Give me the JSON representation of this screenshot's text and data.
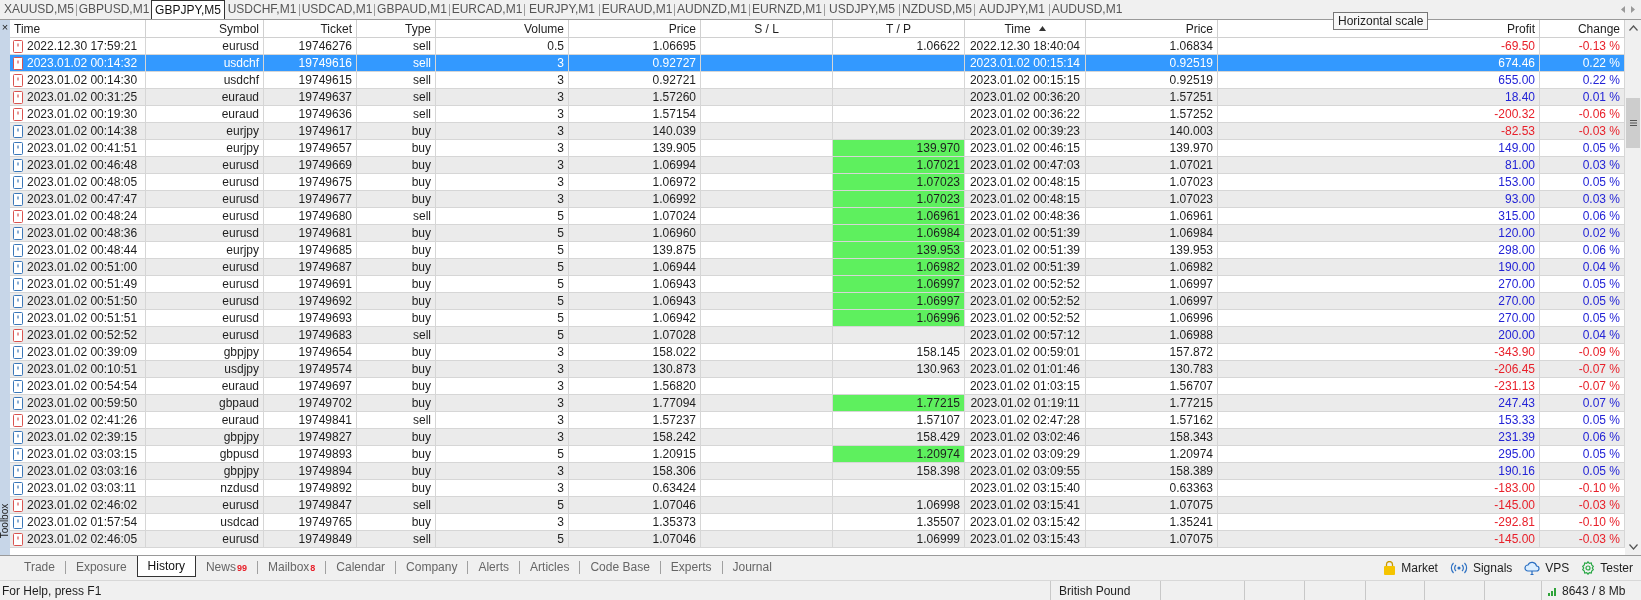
{
  "chart_tabs": [
    {
      "label": "XAUUSD,M5",
      "selected": false
    },
    {
      "label": "GBPUSD,M1",
      "selected": false
    },
    {
      "label": "GBPJPY,M5",
      "selected": true
    },
    {
      "label": "USDCHF,M1",
      "selected": false
    },
    {
      "label": "USDCAD,M1",
      "selected": false
    },
    {
      "label": "GBPAUD,M1",
      "selected": false
    },
    {
      "label": "EURCAD,M1",
      "selected": false
    },
    {
      "label": "EURJPY,M1",
      "selected": false
    },
    {
      "label": "EURAUD,M1",
      "selected": false
    },
    {
      "label": "AUDNZD,M1",
      "selected": false
    },
    {
      "label": "EURNZD,M1",
      "selected": false
    },
    {
      "label": "USDJPY,M5",
      "selected": false
    },
    {
      "label": "NZDUSD,M5",
      "selected": false
    },
    {
      "label": "AUDJPY,M1",
      "selected": false
    },
    {
      "label": "AUDUSD,M1",
      "selected": false
    }
  ],
  "tooltip": "Horizontal scale",
  "toolbox": {
    "close": "×",
    "label": "Toolbox"
  },
  "table": {
    "columns": [
      {
        "label": "Time",
        "sorted": false
      },
      {
        "label": "Symbol",
        "sorted": false
      },
      {
        "label": "Ticket",
        "sorted": false
      },
      {
        "label": "Type",
        "sorted": false
      },
      {
        "label": "Volume",
        "sorted": false
      },
      {
        "label": "Price",
        "sorted": false
      },
      {
        "label": "S / L",
        "sorted": false
      },
      {
        "label": "T / P",
        "sorted": false
      },
      {
        "label": "Time",
        "sorted": true
      },
      {
        "label": "Price",
        "sorted": false
      },
      {
        "label": "Profit",
        "sorted": false
      },
      {
        "label": "Change",
        "sorted": false
      }
    ],
    "rows": [
      {
        "kind": "sell",
        "selected": false,
        "time": "2022.12.30 17:59:21",
        "symbol": "eurusd",
        "ticket": "19746276",
        "type": "sell",
        "volume": "0.5",
        "price": "1.06695",
        "tp": "1.06622",
        "tp_hit": false,
        "close_time": "2022.12.30 18:40:04",
        "close_price": "1.06834",
        "profit": "-69.50",
        "change": "-0.13 %",
        "loss": true
      },
      {
        "kind": "sell",
        "selected": true,
        "time": "2023.01.02 00:14:32",
        "symbol": "usdchf",
        "ticket": "19749616",
        "type": "sell",
        "volume": "3",
        "price": "0.92727",
        "tp_hit": false,
        "close_time": "2023.01.02 00:15:14",
        "close_price": "0.92519",
        "profit": "674.46",
        "change": "0.22 %"
      },
      {
        "kind": "sell",
        "selected": false,
        "time": "2023.01.02 00:14:30",
        "symbol": "usdchf",
        "ticket": "19749615",
        "type": "sell",
        "volume": "3",
        "price": "0.92721",
        "tp_hit": false,
        "close_time": "2023.01.02 00:15:15",
        "close_price": "0.92519",
        "profit": "655.00",
        "change": "0.22 %",
        "loss": false
      },
      {
        "kind": "sell",
        "selected": false,
        "time": "2023.01.02 00:31:25",
        "symbol": "euraud",
        "ticket": "19749637",
        "type": "sell",
        "volume": "3",
        "price": "1.57260",
        "tp_hit": false,
        "close_time": "2023.01.02 00:36:20",
        "close_price": "1.57251",
        "profit": "18.40",
        "change": "0.01 %",
        "loss": false
      },
      {
        "kind": "sell",
        "selected": false,
        "time": "2023.01.02 00:19:30",
        "symbol": "euraud",
        "ticket": "19749636",
        "type": "sell",
        "volume": "3",
        "price": "1.57154",
        "tp_hit": false,
        "close_time": "2023.01.02 00:36:22",
        "close_price": "1.57252",
        "profit": "-200.32",
        "change": "-0.06 %",
        "loss": true
      },
      {
        "kind": "buy",
        "selected": false,
        "time": "2023.01.02 00:14:38",
        "symbol": "eurjpy",
        "ticket": "19749617",
        "type": "buy",
        "volume": "3",
        "price": "140.039",
        "tp_hit": false,
        "close_time": "2023.01.02 00:39:23",
        "close_price": "140.003",
        "profit": "-82.53",
        "change": "-0.03 %",
        "loss": true
      },
      {
        "kind": "buy",
        "selected": false,
        "time": "2023.01.02 00:41:51",
        "symbol": "eurjpy",
        "ticket": "19749657",
        "type": "buy",
        "volume": "3",
        "price": "139.905",
        "tp": "139.970",
        "tp_hit": true,
        "close_time": "2023.01.02 00:46:15",
        "close_price": "139.970",
        "profit": "149.00",
        "change": "0.05 %",
        "loss": false
      },
      {
        "kind": "buy",
        "selected": false,
        "time": "2023.01.02 00:46:48",
        "symbol": "eurusd",
        "ticket": "19749669",
        "type": "buy",
        "volume": "3",
        "price": "1.06994",
        "tp": "1.07021",
        "tp_hit": true,
        "close_time": "2023.01.02 00:47:03",
        "close_price": "1.07021",
        "profit": "81.00",
        "change": "0.03 %",
        "loss": false
      },
      {
        "kind": "buy",
        "selected": false,
        "time": "2023.01.02 00:48:05",
        "symbol": "eurusd",
        "ticket": "19749675",
        "type": "buy",
        "volume": "3",
        "price": "1.06972",
        "tp": "1.07023",
        "tp_hit": true,
        "close_time": "2023.01.02 00:48:15",
        "close_price": "1.07023",
        "profit": "153.00",
        "change": "0.05 %",
        "loss": false
      },
      {
        "kind": "buy",
        "selected": false,
        "time": "2023.01.02 00:47:47",
        "symbol": "eurusd",
        "ticket": "19749677",
        "type": "buy",
        "volume": "3",
        "price": "1.06992",
        "tp": "1.07023",
        "tp_hit": true,
        "close_time": "2023.01.02 00:48:15",
        "close_price": "1.07023",
        "profit": "93.00",
        "change": "0.03 %",
        "loss": false
      },
      {
        "kind": "sell",
        "selected": false,
        "time": "2023.01.02 00:48:24",
        "symbol": "eurusd",
        "ticket": "19749680",
        "type": "sell",
        "volume": "5",
        "price": "1.07024",
        "tp": "1.06961",
        "tp_hit": true,
        "close_time": "2023.01.02 00:48:36",
        "close_price": "1.06961",
        "profit": "315.00",
        "change": "0.06 %",
        "loss": false
      },
      {
        "kind": "buy",
        "selected": false,
        "time": "2023.01.02 00:48:36",
        "symbol": "eurusd",
        "ticket": "19749681",
        "type": "buy",
        "volume": "5",
        "price": "1.06960",
        "tp": "1.06984",
        "tp_hit": true,
        "close_time": "2023.01.02 00:51:39",
        "close_price": "1.06984",
        "profit": "120.00",
        "change": "0.02 %",
        "loss": false
      },
      {
        "kind": "buy",
        "selected": false,
        "time": "2023.01.02 00:48:44",
        "symbol": "eurjpy",
        "ticket": "19749685",
        "type": "buy",
        "volume": "5",
        "price": "139.875",
        "tp": "139.953",
        "tp_hit": true,
        "close_time": "2023.01.02 00:51:39",
        "close_price": "139.953",
        "profit": "298.00",
        "change": "0.06 %",
        "loss": false
      },
      {
        "kind": "buy",
        "selected": false,
        "time": "2023.01.02 00:51:00",
        "symbol": "eurusd",
        "ticket": "19749687",
        "type": "buy",
        "volume": "5",
        "price": "1.06944",
        "tp": "1.06982",
        "tp_hit": true,
        "close_time": "2023.01.02 00:51:39",
        "close_price": "1.06982",
        "profit": "190.00",
        "change": "0.04 %",
        "loss": false
      },
      {
        "kind": "buy",
        "selected": false,
        "time": "2023.01.02 00:51:49",
        "symbol": "eurusd",
        "ticket": "19749691",
        "type": "buy",
        "volume": "5",
        "price": "1.06943",
        "tp": "1.06997",
        "tp_hit": true,
        "close_time": "2023.01.02 00:52:52",
        "close_price": "1.06997",
        "profit": "270.00",
        "change": "0.05 %",
        "loss": false
      },
      {
        "kind": "buy",
        "selected": false,
        "time": "2023.01.02 00:51:50",
        "symbol": "eurusd",
        "ticket": "19749692",
        "type": "buy",
        "volume": "5",
        "price": "1.06943",
        "tp": "1.06997",
        "tp_hit": true,
        "close_time": "2023.01.02 00:52:52",
        "close_price": "1.06997",
        "profit": "270.00",
        "change": "0.05 %",
        "loss": false
      },
      {
        "kind": "buy",
        "selected": false,
        "time": "2023.01.02 00:51:51",
        "symbol": "eurusd",
        "ticket": "19749693",
        "type": "buy",
        "volume": "5",
        "price": "1.06942",
        "tp": "1.06996",
        "tp_hit": true,
        "close_time": "2023.01.02 00:52:52",
        "close_price": "1.06996",
        "profit": "270.00",
        "change": "0.05 %",
        "loss": false
      },
      {
        "kind": "sell",
        "selected": false,
        "time": "2023.01.02 00:52:52",
        "symbol": "eurusd",
        "ticket": "19749683",
        "type": "sell",
        "volume": "5",
        "price": "1.07028",
        "tp_hit": false,
        "close_time": "2023.01.02 00:57:12",
        "close_price": "1.06988",
        "profit": "200.00",
        "change": "0.04 %",
        "loss": false
      },
      {
        "kind": "buy",
        "selected": false,
        "time": "2023.01.02 00:39:09",
        "symbol": "gbpjpy",
        "ticket": "19749654",
        "type": "buy",
        "volume": "3",
        "price": "158.022",
        "tp": "158.145",
        "tp_hit": false,
        "close_time": "2023.01.02 00:59:01",
        "close_price": "157.872",
        "profit": "-343.90",
        "change": "-0.09 %",
        "loss": true
      },
      {
        "kind": "buy",
        "selected": false,
        "time": "2023.01.02 00:10:51",
        "symbol": "usdjpy",
        "ticket": "19749574",
        "type": "buy",
        "volume": "3",
        "price": "130.873",
        "tp": "130.963",
        "tp_hit": false,
        "close_time": "2023.01.02 01:01:46",
        "close_price": "130.783",
        "profit": "-206.45",
        "change": "-0.07 %",
        "loss": true
      },
      {
        "kind": "buy",
        "selected": false,
        "time": "2023.01.02 00:54:54",
        "symbol": "euraud",
        "ticket": "19749697",
        "type": "buy",
        "volume": "3",
        "price": "1.56820",
        "tp_hit": false,
        "close_time": "2023.01.02 01:03:15",
        "close_price": "1.56707",
        "profit": "-231.13",
        "change": "-0.07 %",
        "loss": true
      },
      {
        "kind": "buy",
        "selected": false,
        "time": "2023.01.02 00:59:50",
        "symbol": "gbpaud",
        "ticket": "19749702",
        "type": "buy",
        "volume": "3",
        "price": "1.77094",
        "tp": "1.77215",
        "tp_hit": true,
        "close_time": "2023.01.02 01:19:11",
        "close_price": "1.77215",
        "profit": "247.43",
        "change": "0.07 %",
        "loss": false
      },
      {
        "kind": "sell",
        "selected": false,
        "time": "2023.01.02 02:41:26",
        "symbol": "euraud",
        "ticket": "19749841",
        "type": "sell",
        "volume": "3",
        "price": "1.57237",
        "tp": "1.57107",
        "tp_hit": false,
        "close_time": "2023.01.02 02:47:28",
        "close_price": "1.57162",
        "profit": "153.33",
        "change": "0.05 %",
        "loss": false
      },
      {
        "kind": "buy",
        "selected": false,
        "time": "2023.01.02 02:39:15",
        "symbol": "gbpjpy",
        "ticket": "19749827",
        "type": "buy",
        "volume": "3",
        "price": "158.242",
        "tp": "158.429",
        "tp_hit": false,
        "close_time": "2023.01.02 03:02:46",
        "close_price": "158.343",
        "profit": "231.39",
        "change": "0.06 %",
        "loss": false
      },
      {
        "kind": "buy",
        "selected": false,
        "time": "2023.01.02 03:03:15",
        "symbol": "gbpusd",
        "ticket": "19749893",
        "type": "buy",
        "volume": "5",
        "price": "1.20915",
        "tp": "1.20974",
        "tp_hit": true,
        "close_time": "2023.01.02 03:09:29",
        "close_price": "1.20974",
        "profit": "295.00",
        "change": "0.05 %",
        "loss": false
      },
      {
        "kind": "buy",
        "selected": false,
        "time": "2023.01.02 03:03:16",
        "symbol": "gbpjpy",
        "ticket": "19749894",
        "type": "buy",
        "volume": "3",
        "price": "158.306",
        "tp": "158.398",
        "tp_hit": false,
        "close_time": "2023.01.02 03:09:55",
        "close_price": "158.389",
        "profit": "190.16",
        "change": "0.05 %",
        "loss": false
      },
      {
        "kind": "buy",
        "selected": false,
        "time": "2023.01.02 03:03:11",
        "symbol": "nzdusd",
        "ticket": "19749892",
        "type": "buy",
        "volume": "3",
        "price": "0.63424",
        "tp_hit": false,
        "close_time": "2023.01.02 03:15:40",
        "close_price": "0.63363",
        "profit": "-183.00",
        "change": "-0.10 %",
        "loss": true
      },
      {
        "kind": "sell",
        "selected": false,
        "time": "2023.01.02 02:46:02",
        "symbol": "eurusd",
        "ticket": "19749847",
        "type": "sell",
        "volume": "5",
        "price": "1.07046",
        "tp": "1.06998",
        "tp_hit": false,
        "close_time": "2023.01.02 03:15:41",
        "close_price": "1.07075",
        "profit": "-145.00",
        "change": "-0.03 %",
        "loss": true
      },
      {
        "kind": "buy",
        "selected": false,
        "time": "2023.01.02 01:57:54",
        "symbol": "usdcad",
        "ticket": "19749765",
        "type": "buy",
        "volume": "3",
        "price": "1.35373",
        "tp": "1.35507",
        "tp_hit": false,
        "close_time": "2023.01.02 03:15:42",
        "close_price": "1.35241",
        "profit": "-292.81",
        "change": "-0.10 %",
        "loss": true
      },
      {
        "kind": "sell",
        "selected": false,
        "time": "2023.01.02 02:46:05",
        "symbol": "eurusd",
        "ticket": "19749849",
        "type": "sell",
        "volume": "5",
        "price": "1.07046",
        "tp": "1.06999",
        "tp_hit": false,
        "close_time": "2023.01.02 03:15:43",
        "close_price": "1.07075",
        "profit": "-145.00",
        "change": "-0.03 %",
        "loss": true
      }
    ]
  },
  "bottom_tabs": [
    {
      "label": "Trade",
      "selected": false
    },
    {
      "label": "Exposure",
      "selected": false
    },
    {
      "label": "History",
      "selected": true
    },
    {
      "label": "News",
      "badge": "99",
      "selected": false
    },
    {
      "label": "Mailbox",
      "badge": "8",
      "selected": false
    },
    {
      "label": "Calendar",
      "selected": false
    },
    {
      "label": "Company",
      "selected": false
    },
    {
      "label": "Alerts",
      "selected": false
    },
    {
      "label": "Articles",
      "selected": false
    },
    {
      "label": "Code Base",
      "selected": false
    },
    {
      "label": "Experts",
      "selected": false
    },
    {
      "label": "Journal",
      "selected": false
    }
  ],
  "services": [
    {
      "kind": "market",
      "label": "Market"
    },
    {
      "kind": "signals",
      "label": "Signals"
    },
    {
      "kind": "vps",
      "label": "VPS"
    },
    {
      "kind": "tester",
      "label": "Tester"
    }
  ],
  "status_bar": {
    "help": "For Help, press F1",
    "profile": "British Pound",
    "memory": "8643 / 8 Mb"
  }
}
